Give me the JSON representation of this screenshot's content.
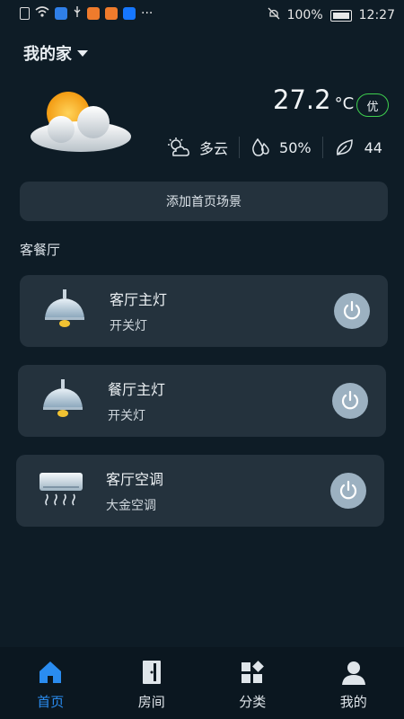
{
  "status_bar": {
    "battery": "100%",
    "time": "12:27",
    "more": "···"
  },
  "home": {
    "title": "我的家"
  },
  "weather": {
    "temperature": "27.2",
    "unit": "°C",
    "air_quality": "优",
    "condition": "多云",
    "humidity": "50%",
    "aqi_value": "44"
  },
  "scene_button": {
    "label": "添加首页场景"
  },
  "section": {
    "title": "客餐厅"
  },
  "devices": [
    {
      "name": "客厅主灯",
      "type": "开关灯",
      "icon": "ceiling-lamp-icon"
    },
    {
      "name": "餐厅主灯",
      "type": "开关灯",
      "icon": "ceiling-lamp-icon"
    },
    {
      "name": "客厅空调",
      "type": "大金空调",
      "icon": "air-conditioner-icon"
    }
  ],
  "bottom_nav": [
    {
      "label": "首页",
      "icon": "home-icon",
      "active": true
    },
    {
      "label": "房间",
      "icon": "door-icon",
      "active": false
    },
    {
      "label": "分类",
      "icon": "category-icon",
      "active": false
    },
    {
      "label": "我的",
      "icon": "user-icon",
      "active": false
    }
  ],
  "colors": {
    "background": "#0e1c26",
    "card": "#24323d",
    "accent": "#2a8cf0",
    "aqi_border": "#3ecf4e",
    "power_button": "#9cb1c1"
  }
}
